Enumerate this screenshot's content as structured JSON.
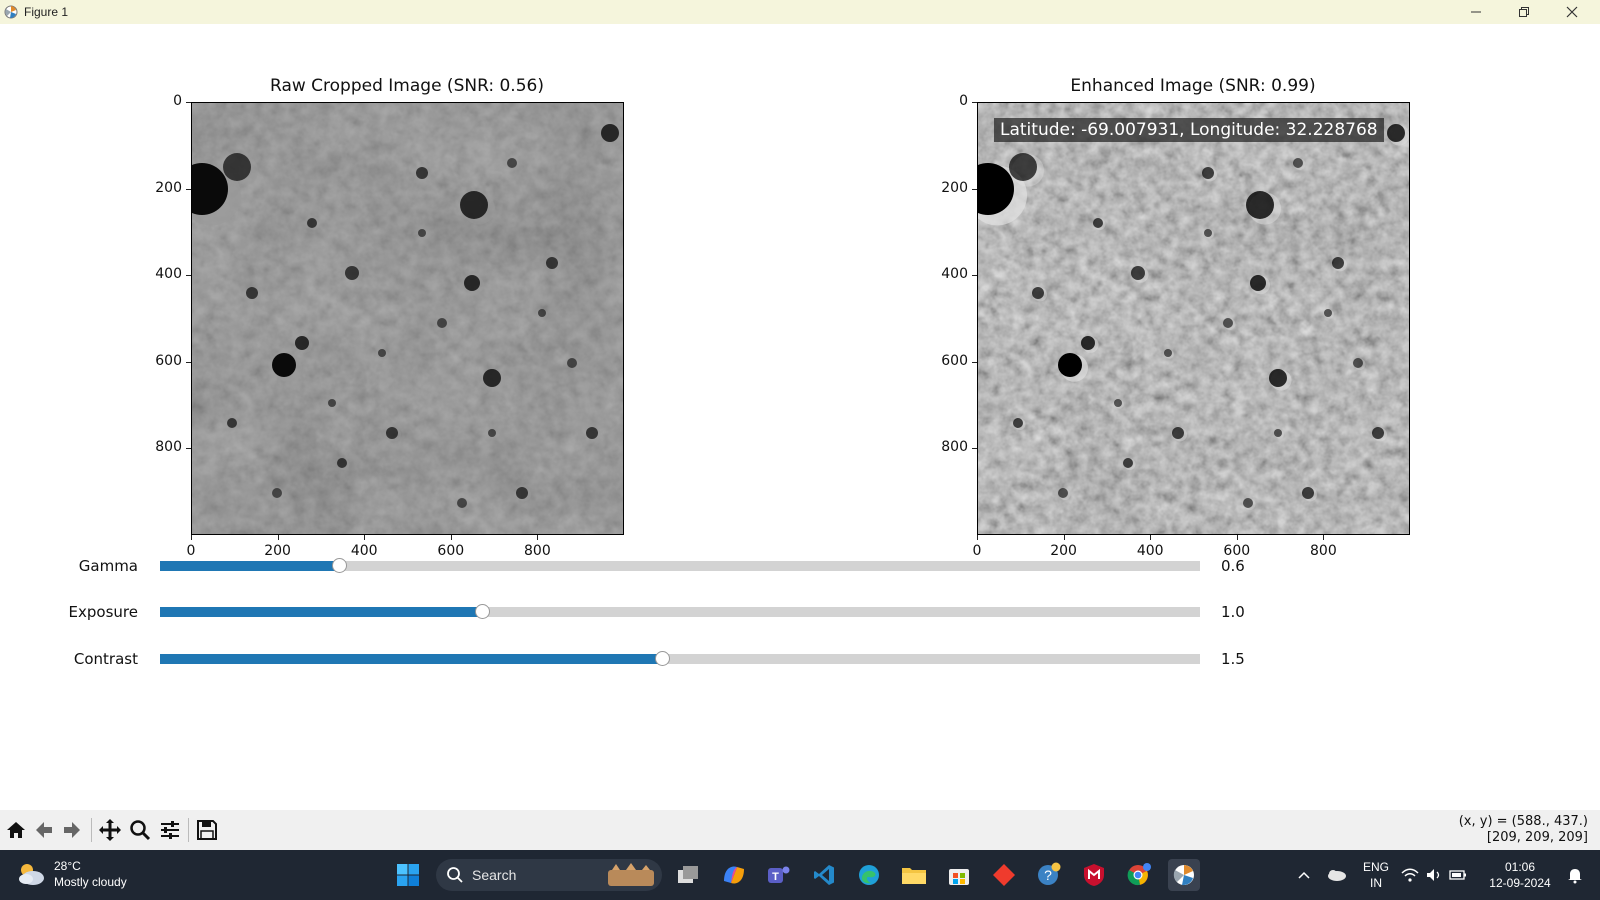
{
  "window": {
    "title": "Figure 1"
  },
  "figure": {
    "left_axes": {
      "title": "Raw Cropped Image (SNR: 0.56)",
      "y_ticks": [
        "0",
        "200",
        "400",
        "600",
        "800"
      ],
      "x_ticks": [
        "0",
        "200",
        "400",
        "600",
        "800"
      ]
    },
    "right_axes": {
      "title": "Enhanced Image (SNR: 0.99)",
      "y_ticks": [
        "0",
        "200",
        "400",
        "600",
        "800"
      ],
      "x_ticks": [
        "0",
        "200",
        "400",
        "600",
        "800"
      ],
      "overlay": "Latitude: -69.007931, Longitude: 32.228768"
    },
    "sliders": [
      {
        "label": "Gamma",
        "value_text": "0.6",
        "fraction": 0.172
      },
      {
        "label": "Exposure",
        "value_text": "1.0",
        "fraction": 0.31
      },
      {
        "label": "Contrast",
        "value_text": "1.5",
        "fraction": 0.483
      }
    ],
    "colors": {
      "slider_fill": "#1f77b4",
      "slider_track": "#d3d3d3"
    }
  },
  "toolbar": {
    "buttons": [
      "home-icon",
      "back-icon",
      "forward-icon",
      "pan-icon",
      "zoom-icon",
      "configure-icon",
      "save-icon"
    ],
    "coords_line1": "(x, y) = (588., 437.)",
    "coords_line2": "[209, 209, 209]"
  },
  "taskbar": {
    "weather_temp": "28°C",
    "weather_desc": "Mostly cloudy",
    "search_label": "Search",
    "lang_top": "ENG",
    "lang_bottom": "IN",
    "time": "01:06",
    "date": "12-09-2024"
  }
}
